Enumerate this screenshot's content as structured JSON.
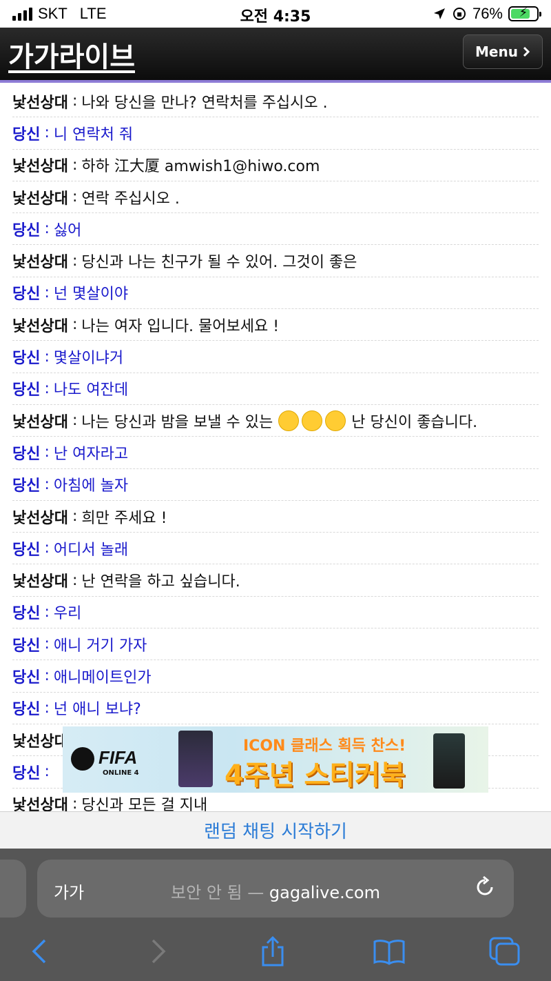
{
  "status_bar": {
    "carrier": "SKT",
    "network": "LTE",
    "time": "오전 4:35",
    "battery_percent": "76%",
    "battery_level": 0.76,
    "battery_color": "#4cd964"
  },
  "header": {
    "logo": "가가라이브",
    "menu_label": "Menu",
    "menu_icon": "chevron-right-icon",
    "accent_color": "#8e7cd6"
  },
  "chat": {
    "separator": ":",
    "stranger_color": "#111111",
    "you_color": "#1a1acc",
    "lines": [
      {
        "speaker": "낯선상대",
        "text": "나와 당신을 만나? 연락처를 주십시오 ."
      },
      {
        "speaker": "당신",
        "text": "니 연락처 줘"
      },
      {
        "speaker": "낯선상대",
        "text": "하하 江大厦 amwish1@hiwo.com"
      },
      {
        "speaker": "낯선상대",
        "text": "연락 주십시오 ."
      },
      {
        "speaker": "당신",
        "text": "싫어"
      },
      {
        "speaker": "낯선상대",
        "text": "당신과 나는 친구가 될 수 있어. 그것이 좋은"
      },
      {
        "speaker": "당신",
        "text": "넌 몇살이야"
      },
      {
        "speaker": "낯선상대",
        "text": "나는 여자 입니다. 물어보세요 !"
      },
      {
        "speaker": "당신",
        "text": "몇살이냐거"
      },
      {
        "speaker": "당신",
        "text": "나도 여잔데"
      },
      {
        "speaker": "낯선상대",
        "text": "나는 당신과 밤을 보낼 수 있는",
        "emoji_count": 3,
        "text_after": "난 당신이 좋습니다."
      },
      {
        "speaker": "당신",
        "text": "난 여자라고"
      },
      {
        "speaker": "당신",
        "text": "아침에 놀자"
      },
      {
        "speaker": "낯선상대",
        "text": "희만 주세요 !"
      },
      {
        "speaker": "당신",
        "text": "어디서 놀래"
      },
      {
        "speaker": "낯선상대",
        "text": "난 연락을 하고 싶습니다."
      },
      {
        "speaker": "당신",
        "text": "우리"
      },
      {
        "speaker": "당신",
        "text": "애니 거기 가자"
      },
      {
        "speaker": "당신",
        "text": "애니메이트인가"
      },
      {
        "speaker": "당신",
        "text": "넌 애니 보냐?"
      },
      {
        "speaker": "낯선상대",
        "text": ""
      },
      {
        "speaker": "당신",
        "text": ""
      },
      {
        "speaker": "낯선상대",
        "text": "당신과 모든 걸 지내"
      }
    ]
  },
  "ad": {
    "brand": "FIFA",
    "brand_sub": "ONLINE 4",
    "line1": "ICON 클래스 획득 찬스!",
    "line2": "4주년 스티커북"
  },
  "random_chat": {
    "label": "랜덤 채팅 시작하기"
  },
  "browser": {
    "text_size_label": "가가",
    "insecure_label": "보안 안 됨 —",
    "domain": "gagalive.com",
    "reload_icon": "reload-icon",
    "toolbar_icons": [
      "back-icon",
      "forward-icon",
      "share-icon",
      "bookmarks-icon",
      "tabs-icon"
    ]
  }
}
